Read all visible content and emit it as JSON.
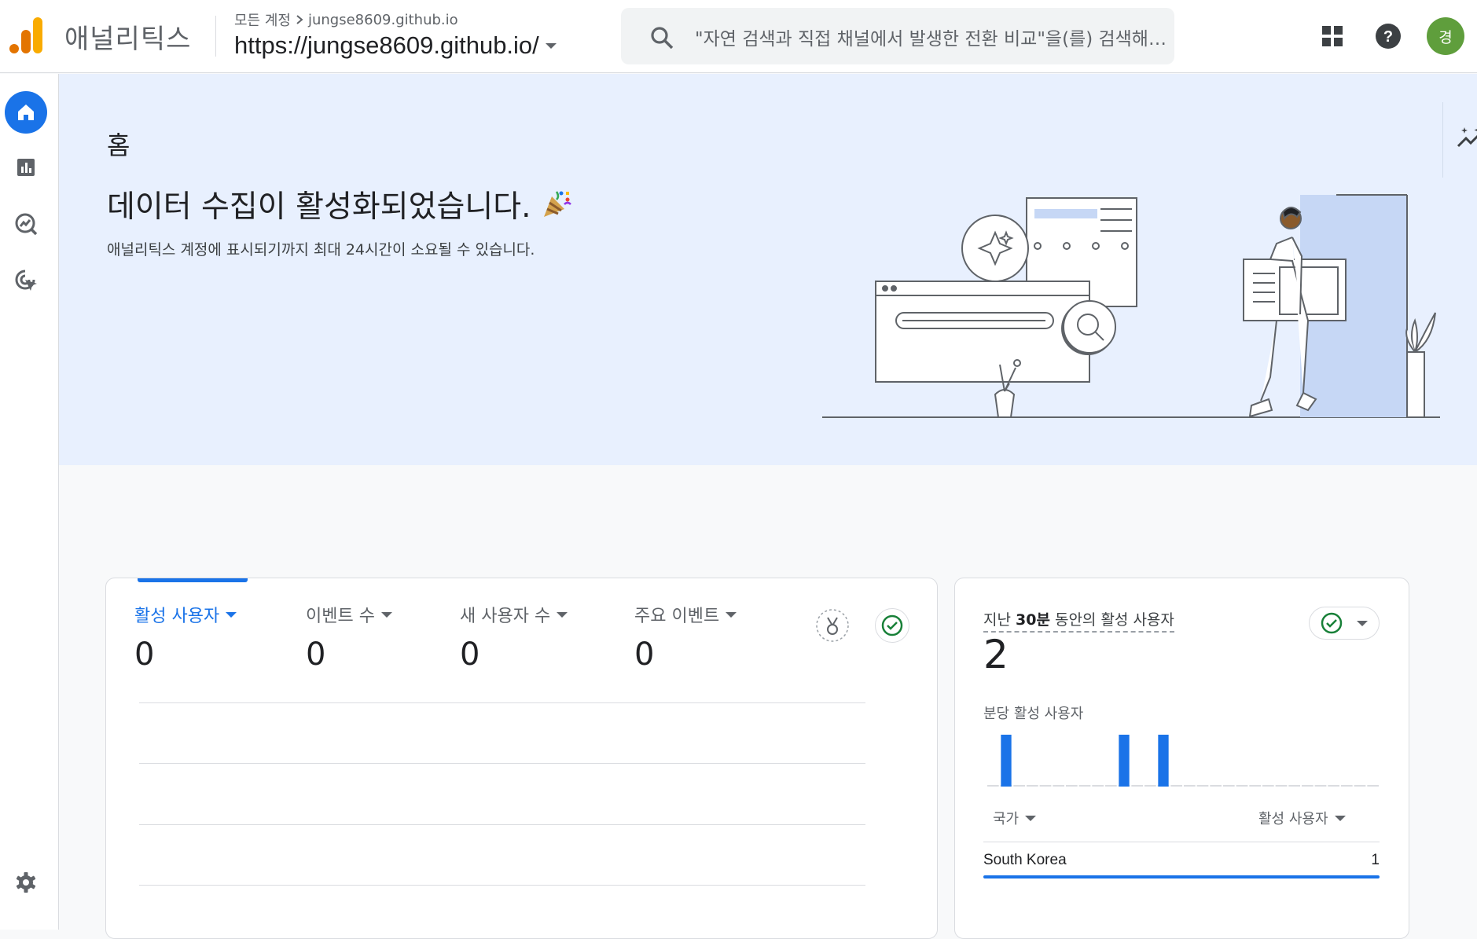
{
  "app": {
    "name": "애널리틱스"
  },
  "breadcrumb": {
    "account": "모든 계정",
    "property_path": "jungse8609.github.io"
  },
  "property": {
    "name": "https://jungse8609.github.io/"
  },
  "search": {
    "placeholder": "\"자연 검색과 직접 채널에서 발생한 전환 비교\"을(를) 검색해 보세요"
  },
  "user": {
    "initial": "경",
    "avatar_color": "#5f9e3c"
  },
  "nav": {
    "items": [
      {
        "name": "home",
        "icon": "home-icon",
        "active": true
      },
      {
        "name": "reports",
        "icon": "bar-chart-icon",
        "active": false
      },
      {
        "name": "explore",
        "icon": "explore-icon",
        "active": false
      },
      {
        "name": "advertising",
        "icon": "target-icon",
        "active": false
      }
    ],
    "settings_icon": "gear-icon"
  },
  "hero": {
    "title": "홈",
    "headline": "데이터 수집이 활성화되었습니다.",
    "subline": "애널리틱스 계정에 표시되기까지 최대 24시간이 소요될 수 있습니다."
  },
  "main_card": {
    "metrics": [
      {
        "label": "활성 사용자",
        "value": "0",
        "selected": true
      },
      {
        "label": "이벤트 수",
        "value": "0",
        "selected": false
      },
      {
        "label": "새 사용자 수",
        "value": "0",
        "selected": false
      },
      {
        "label": "주요 이벤트",
        "value": "0",
        "selected": false
      }
    ]
  },
  "realtime_card": {
    "title_prefix": "지난 ",
    "title_bold": "30분",
    "title_suffix": " 동안의 활성 사용자",
    "value": "2",
    "subtitle": "분당 활성 사용자",
    "col_country": "국가",
    "col_users": "활성 사용자",
    "rows": [
      {
        "country": "South Korea",
        "users": "1"
      }
    ]
  },
  "colors": {
    "accent": "#1a73e8",
    "success": "#188038",
    "hero_bg": "#e8f0fe"
  },
  "chart_data": {
    "type": "bar",
    "title": "분당 활성 사용자",
    "values": [
      0,
      1,
      0,
      0,
      0,
      0,
      0,
      0,
      0,
      0,
      1,
      0,
      0,
      1,
      0,
      0,
      0,
      0,
      0,
      0,
      0,
      0,
      0,
      0,
      0,
      0,
      0,
      0,
      0,
      0
    ],
    "ylim": [
      0,
      1
    ]
  }
}
